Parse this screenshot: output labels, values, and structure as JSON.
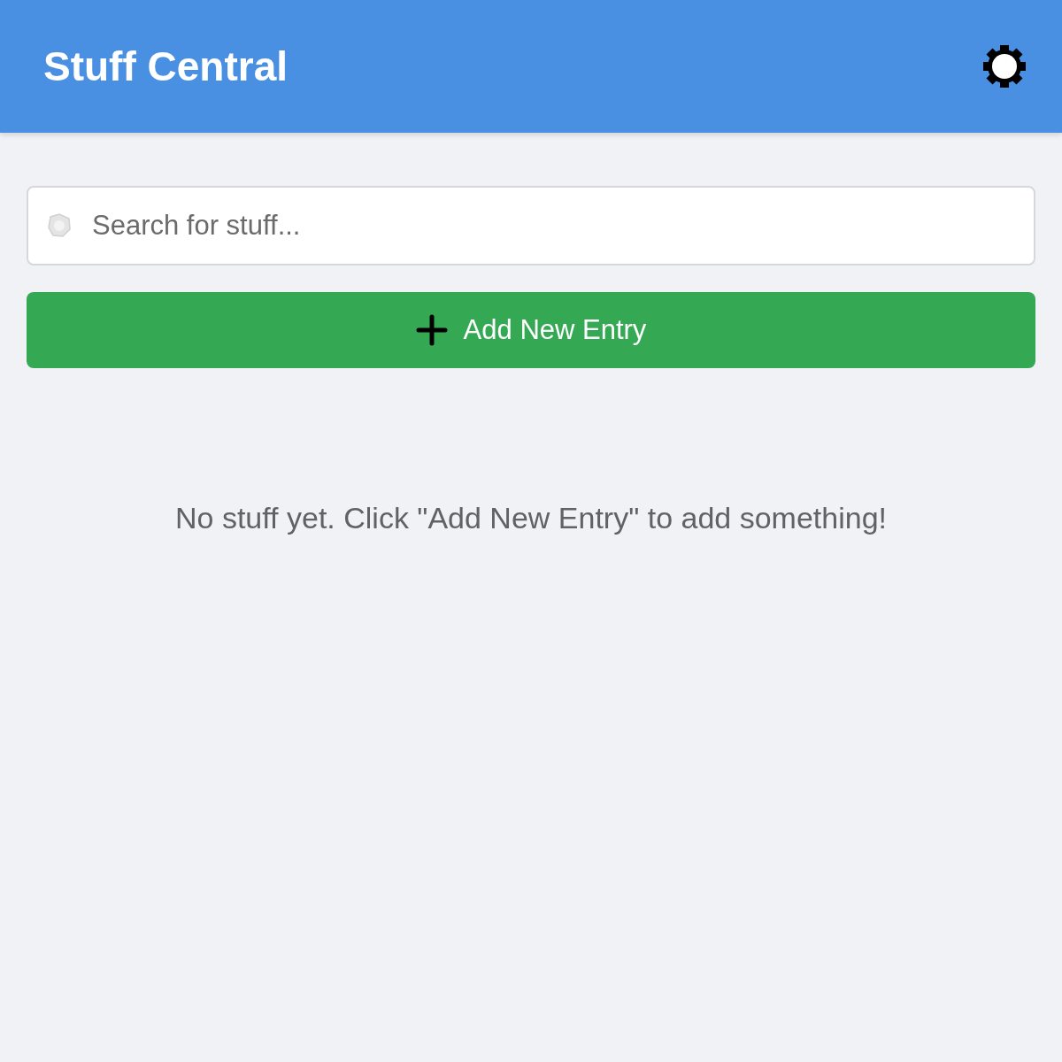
{
  "header": {
    "title": "Stuff Central"
  },
  "search": {
    "placeholder": "Search for stuff..."
  },
  "add_button": {
    "label": "Add New Entry"
  },
  "empty_message": "No stuff yet. Click \"Add New Entry\" to add something!"
}
